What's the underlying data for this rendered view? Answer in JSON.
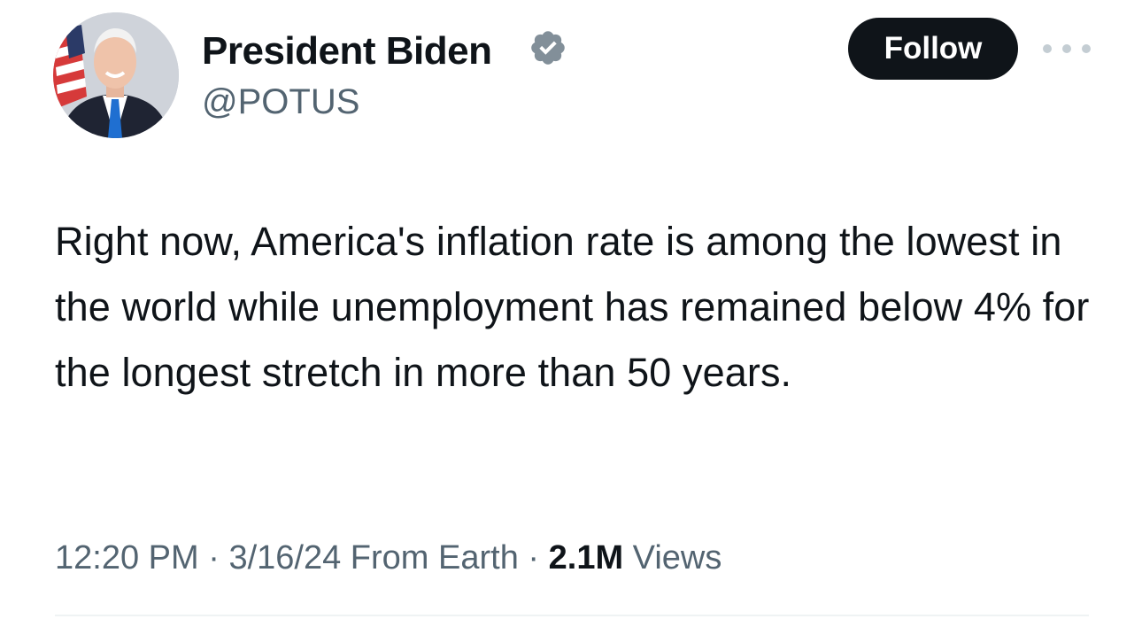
{
  "tweet": {
    "author": {
      "display_name": "President Biden",
      "handle": "@POTUS",
      "verified_icon": "verified-badge-icon",
      "avatar_icon": "avatar"
    },
    "actions": {
      "follow_label": "Follow",
      "more_icon": "more-options-icon"
    },
    "text": "Right now, America's inflation rate is among the lowest in the world while unemployment has remained below 4% for the longest stretch in more than 50 years.",
    "meta": {
      "time": "12:20 PM",
      "separator_1": " · ",
      "date": "3/16/24",
      "source": " From Earth",
      "separator_2": " · ",
      "views_count": "2.1M",
      "views_label": " Views"
    }
  },
  "colors": {
    "text_primary": "#0f1419",
    "text_secondary": "#536471",
    "verified_badge": "#828f99",
    "follow_button_bg": "#0f1419",
    "follow_button_text": "#ffffff",
    "divider": "#eff3f4"
  }
}
